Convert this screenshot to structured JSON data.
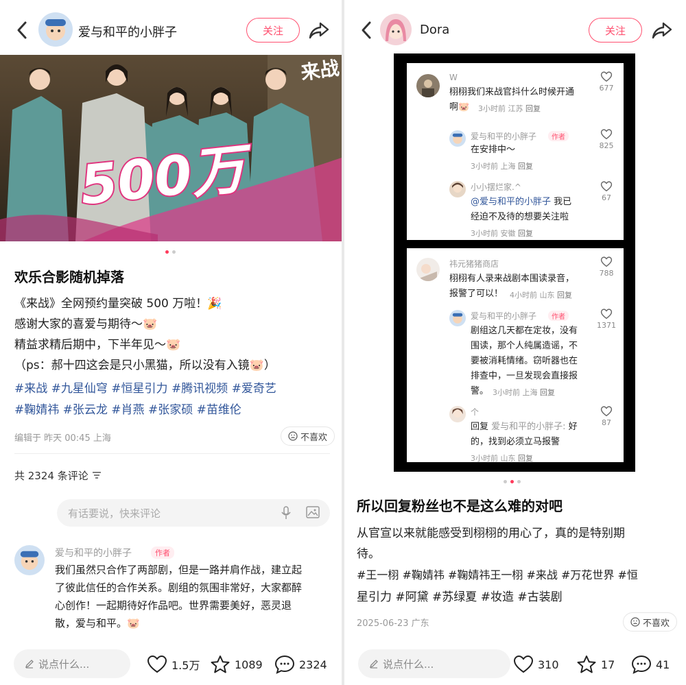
{
  "left": {
    "header": {
      "username": "爱与和平的小胖子",
      "follow_label": "关注"
    },
    "photo": {
      "overlay_text": "500万",
      "corner_text": "来战"
    },
    "post": {
      "title": "欢乐合影随机掉落",
      "lines": [
        "《来战》全网预约量突破 500 万啦！🎉",
        "感谢大家的喜爱与期待～🐷",
        "精益求精后期中，下半年见～🐷",
        "（ps：郝十四这会是只小黑猫，所以没有入镜🐷）"
      ],
      "tags_line1": "#来战 #九星仙穹 #恒星引力 #腾讯视频 #爱奇艺",
      "tags_line2": "#鞠婧祎 #张云龙 #肖燕 #张家硕 #苗维伦",
      "edited": "编辑于 昨天 00:45 上海",
      "dislike_label": "不喜欢"
    },
    "comments": {
      "count_label": "共 2324 条评论",
      "input_placeholder": "有话要说，快来评论",
      "first": {
        "name": "爱与和平的小胖子",
        "badge": "作者",
        "lines": [
          "我们虽然只合作了两部剧，但是一路并肩作战，建立起",
          "了彼此信任的合作关系。剧组的氛围非常好，大家都醉",
          "心创作！一起期待好作品吧。世界需要美好，恶灵退",
          "散，爱与和平。🐷"
        ]
      }
    },
    "bottom": {
      "say_placeholder": "说点什么...",
      "likes": "1.5万",
      "stars": "1089",
      "comments": "2324"
    }
  },
  "right": {
    "header": {
      "username": "Dora",
      "follow_label": "关注"
    },
    "screenshot": {
      "c1": {
        "name": "W",
        "lines": [
          "栩栩我们来战官抖什么时候开通",
          "啊🐷"
        ],
        "meta_time": "3小时前 江苏",
        "reply": "回复",
        "likes": "677"
      },
      "c1r1": {
        "name": "爱与和平的小胖子",
        "badge": "作者",
        "lines": [
          "在安排中～"
        ],
        "meta_time": "3小时前 上海",
        "reply": "回复",
        "likes": "825"
      },
      "c1r2": {
        "name": "小小摆烂家.^",
        "mention": "@爱与和平的小胖子",
        "lines": [
          " 我已",
          "经迫不及待的想要关注啦"
        ],
        "meta_time": "3小时前 安徽",
        "reply": "回复",
        "likes": "67"
      },
      "c2": {
        "name": "祎元猪猪商店",
        "lines": [
          "栩栩有人录来战剧本围读录音，",
          "报警了可以！"
        ],
        "meta_time": "4小时前 山东",
        "reply": "回复",
        "likes": "788"
      },
      "c2r1": {
        "name": "爱与和平的小胖子",
        "badge": "作者",
        "lines": [
          "剧组这几天都在定妆，没有",
          "围读，那个人纯属造谣，不",
          "要被消耗情绪。窃听器也在",
          "排查中，一旦发现会直接报",
          "警。"
        ],
        "meta_time": "3小时前 上海",
        "reply": "回复",
        "likes": "1371"
      },
      "c2r2": {
        "name": "个",
        "reply_prefix": "回复",
        "reply_to": "爱与和平的小胖子:",
        "lines": [
          " 好",
          "的，找到必须立马报警"
        ],
        "meta_time": "3小时前 山东",
        "reply": "回复",
        "likes": "87"
      }
    },
    "post": {
      "title": "所以回复粉丝也不是这么难的对吧",
      "lines": [
        "从官宣以来就能感受到栩栩的用心了，真的是特别期",
        "待。"
      ],
      "tags_line1": "#王一栩 #鞠婧祎 #鞠婧祎王一栩 #来战 #万花世界 #恒",
      "tags_line2": "星引力 #阿黛 #苏绿夏 #妆造 #古装剧",
      "date": "2025-06-23 广东",
      "dislike_label": "不喜欢"
    },
    "bottom": {
      "say_placeholder": "说点什么...",
      "likes": "310",
      "stars": "17",
      "comments": "41"
    }
  },
  "colors": {
    "accent": "#ff4f6f",
    "tag": "#31569a",
    "muted": "#999999"
  }
}
